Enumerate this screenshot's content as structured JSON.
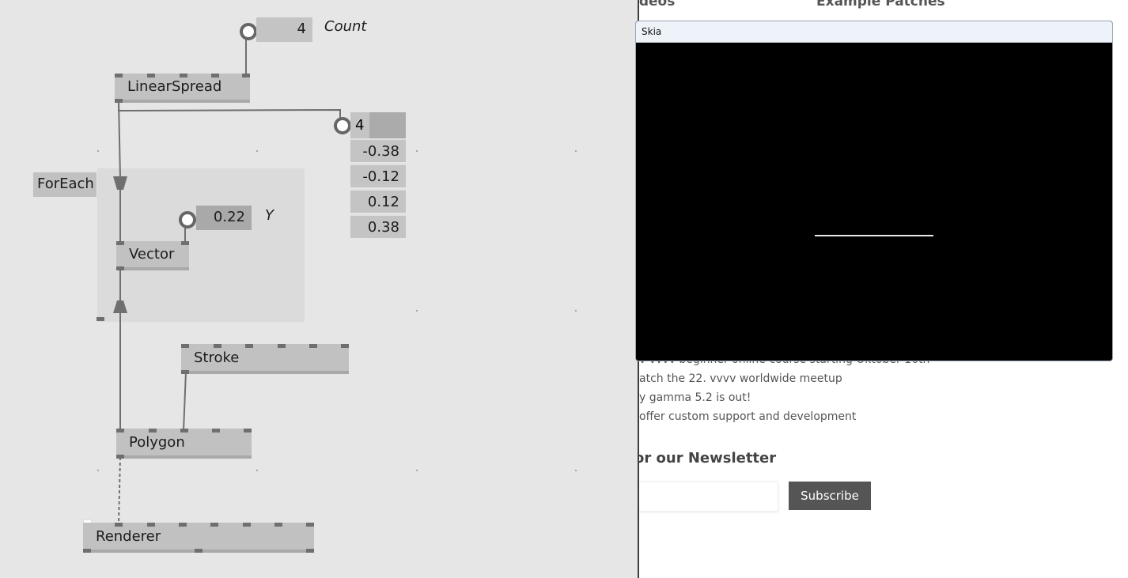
{
  "patch": {
    "count_value": "4",
    "count_label": "Count",
    "nodes": {
      "linearspread": "LinearSpread",
      "foreach": "ForEach",
      "vector": "Vector",
      "stroke": "Stroke",
      "polygon": "Polygon",
      "renderer": "Renderer"
    },
    "y_value": "0.22",
    "y_label": "Y",
    "spread_count": "4",
    "spread_values": [
      "-0.38",
      "-0.12",
      "0.12",
      "0.38"
    ]
  },
  "website": {
    "headings": [
      "ideos",
      "Example Patches"
    ],
    "news": [
      "v vvvv beginner online course starting Oktober 16th",
      "atch the 22. vvvv worldwide meetup",
      "y gamma 5.2 is out!",
      "offer custom support and development"
    ],
    "newsletter_title": "or our Newsletter",
    "subscribe_label": "Subscribe"
  },
  "skia_window": {
    "title": "Skia"
  }
}
